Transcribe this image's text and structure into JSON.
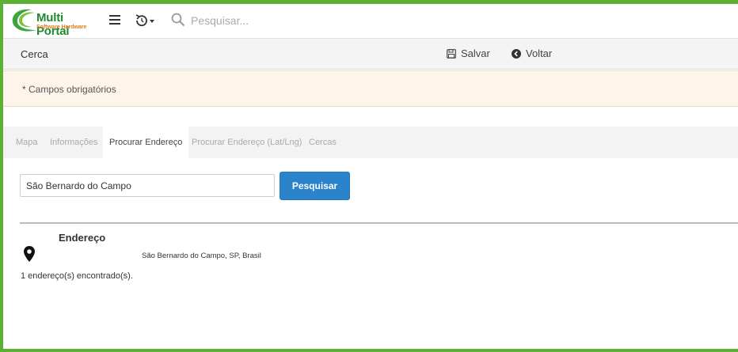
{
  "app": {
    "logo_title": "Multi Portal",
    "logo_subtitle": "Software Hardware",
    "brand_green": "#1f8a2e",
    "brand_orange": "#e07b1a",
    "frame_color": "#5cb034"
  },
  "topbar": {
    "search_placeholder": "Pesquisar...",
    "icons": [
      "menu-icon",
      "history-icon",
      "search-icon"
    ]
  },
  "page": {
    "title": "Cerca",
    "save_label": "Salvar",
    "back_label": "Voltar"
  },
  "notice": {
    "text": "* Campos obrigatórios"
  },
  "tabs": [
    {
      "label": "Mapa",
      "active": false
    },
    {
      "label": "Informações",
      "active": false
    },
    {
      "label": "Procurar Endereço",
      "active": true
    },
    {
      "label": "Procurar Endereço (Lat/Lng)",
      "active": false
    },
    {
      "label": "Cercas",
      "active": false
    }
  ],
  "search": {
    "value": "São Bernardo do Campo",
    "button_label": "Pesquisar",
    "button_color": "#2b83cc"
  },
  "results": {
    "column_header": "Endereço",
    "rows": [
      {
        "address": "São Bernardo do Campo, SP, Brasil",
        "icon": "map-pin-icon"
      }
    ],
    "count_text": "1 endereço(s) encontrado(s)."
  }
}
